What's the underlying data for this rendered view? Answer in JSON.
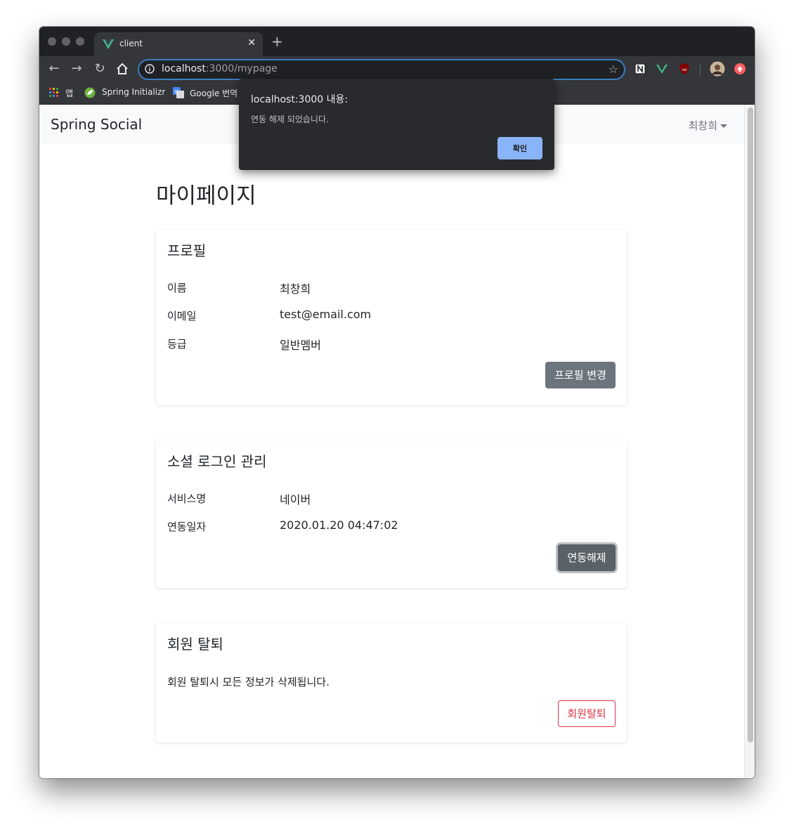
{
  "browser": {
    "tab_title": "client",
    "tab_close": "✕",
    "new_tab": "+",
    "url_host": "localhost",
    "url_path": ":3000/mypage",
    "bookmarks": [
      {
        "label": "앱"
      },
      {
        "label": "Spring Initializr"
      },
      {
        "label": "Google 번역"
      }
    ]
  },
  "alert": {
    "title": "localhost:3000 내용:",
    "message": "연동 해제 되었습니다.",
    "ok_label": "확인"
  },
  "navbar": {
    "brand": "Spring Social",
    "user_name": "최창희"
  },
  "page": {
    "title": "마이페이지"
  },
  "profile": {
    "title": "프로필",
    "rows": [
      {
        "label": "이름",
        "value": "최창희"
      },
      {
        "label": "이메일",
        "value": "test@email.com"
      },
      {
        "label": "등급",
        "value": "일반멤버"
      }
    ],
    "button_label": "프로필 변경"
  },
  "social": {
    "title": "소셜 로그인 관리",
    "rows": [
      {
        "label": "서비스명",
        "value": "네이버"
      },
      {
        "label": "연동일자",
        "value": "2020.01.20 04:47:02"
      }
    ],
    "button_label": "연동해제"
  },
  "withdraw": {
    "title": "회원 탈퇴",
    "description": "회원 탈퇴시 모든 정보가 삭제됩니다.",
    "button_label": "회원탈퇴"
  },
  "colors": {
    "chrome_dark": "#202124",
    "chrome_toolbar": "#35363a",
    "omnibox_focus": "#3b7fc4",
    "navbar_bg": "#f8f9fa",
    "btn_secondary": "#6c757d",
    "danger": "#dc3545",
    "alert_button": "#8ab4f8"
  },
  "icons": [
    "vue-logo-icon",
    "info-icon",
    "star-icon",
    "back-arrow-icon",
    "forward-arrow-icon",
    "reload-icon",
    "home-icon",
    "apps-grid-icon",
    "spring-leaf-icon",
    "google-translate-icon",
    "notion-icon",
    "vue-devtools-icon",
    "ublock-icon",
    "avatar-icon",
    "extension-up-icon",
    "caret-down-icon"
  ]
}
